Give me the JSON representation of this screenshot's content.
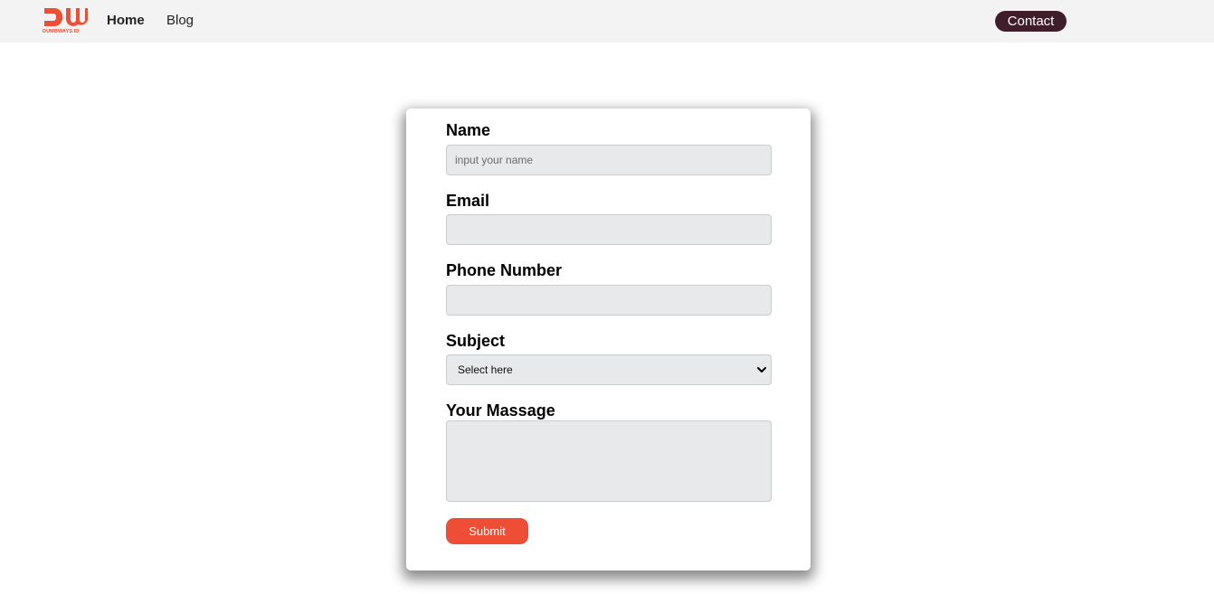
{
  "navbar": {
    "logo_text": "DUMBWAYS.ID",
    "links": [
      {
        "label": "Home"
      },
      {
        "label": "Blog"
      }
    ],
    "contact_label": "Contact"
  },
  "form": {
    "name": {
      "label": "Name",
      "placeholder": "input your name",
      "value": ""
    },
    "email": {
      "label": "Email",
      "placeholder": "",
      "value": ""
    },
    "phone": {
      "label": "Phone Number",
      "placeholder": "",
      "value": ""
    },
    "subject": {
      "label": "Subject",
      "selected": "Select here"
    },
    "message": {
      "label": "Your Massage",
      "value": ""
    },
    "submit_label": "Submit"
  },
  "colors": {
    "brand": "#ee4d36",
    "contact_bg": "#3f1d2b",
    "navbar_bg": "#f3f3f3",
    "input_bg": "#e7e9ea"
  }
}
